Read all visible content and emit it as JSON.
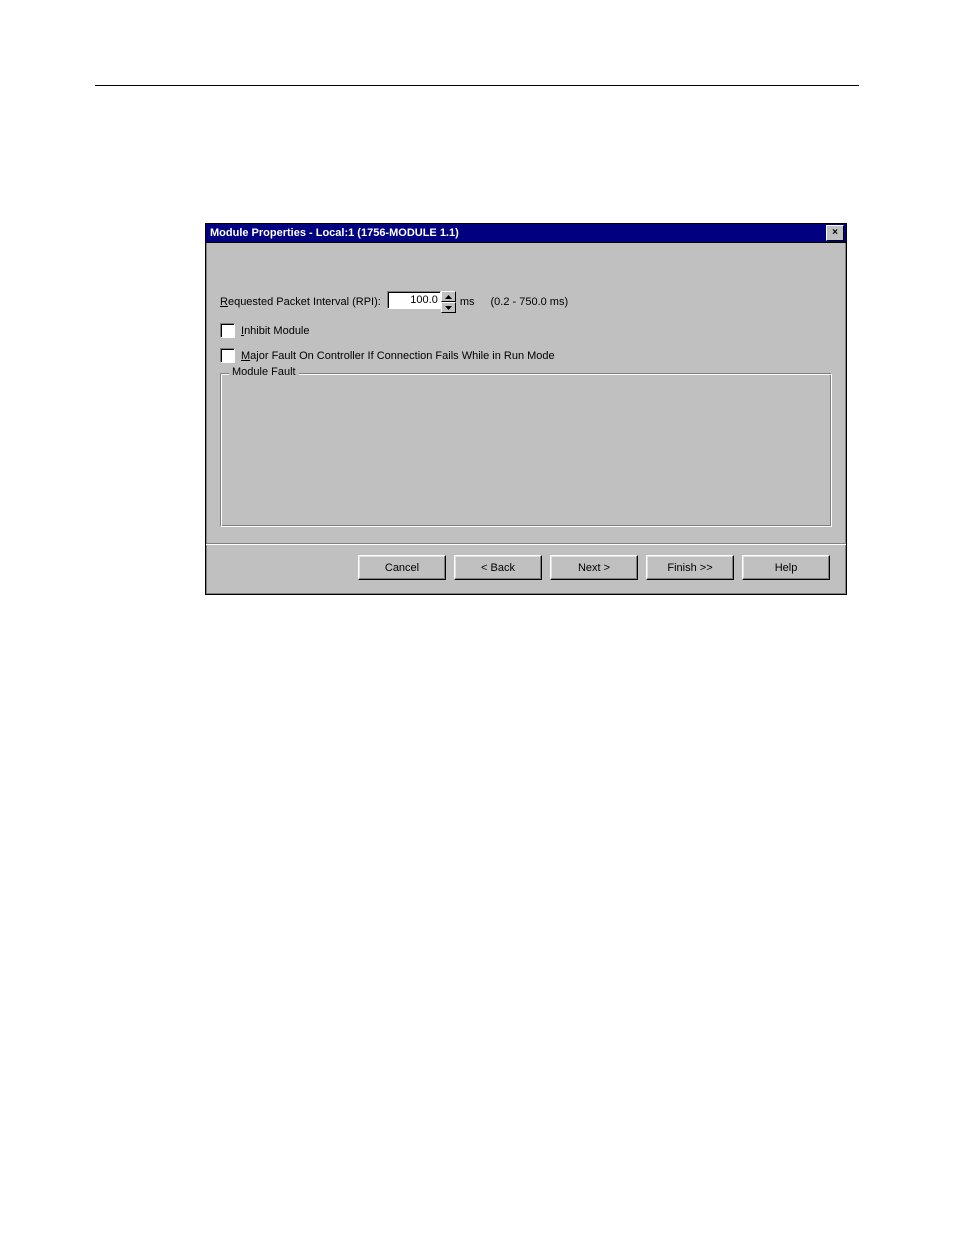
{
  "titlebar": {
    "title": "Module Properties - Local:1 (1756-MODULE 1.1)",
    "close_glyph": "×"
  },
  "rpi": {
    "label_prefix": "R",
    "label_rest": "equested Packet Interval (RPI):",
    "value": "100.0",
    "unit": "ms",
    "range": "(0.2 - 750.0 ms)"
  },
  "inhibit": {
    "access": "I",
    "rest": "nhibit Module"
  },
  "major_fault": {
    "access": "M",
    "rest": "ajor Fault On Controller If Connection Fails While in Run Mode"
  },
  "groupbox": {
    "legend": "Module Fault"
  },
  "buttons": {
    "cancel": "Cancel",
    "back": "< Back",
    "next": "Next >",
    "finish": "Finish >>",
    "help": "Help"
  }
}
